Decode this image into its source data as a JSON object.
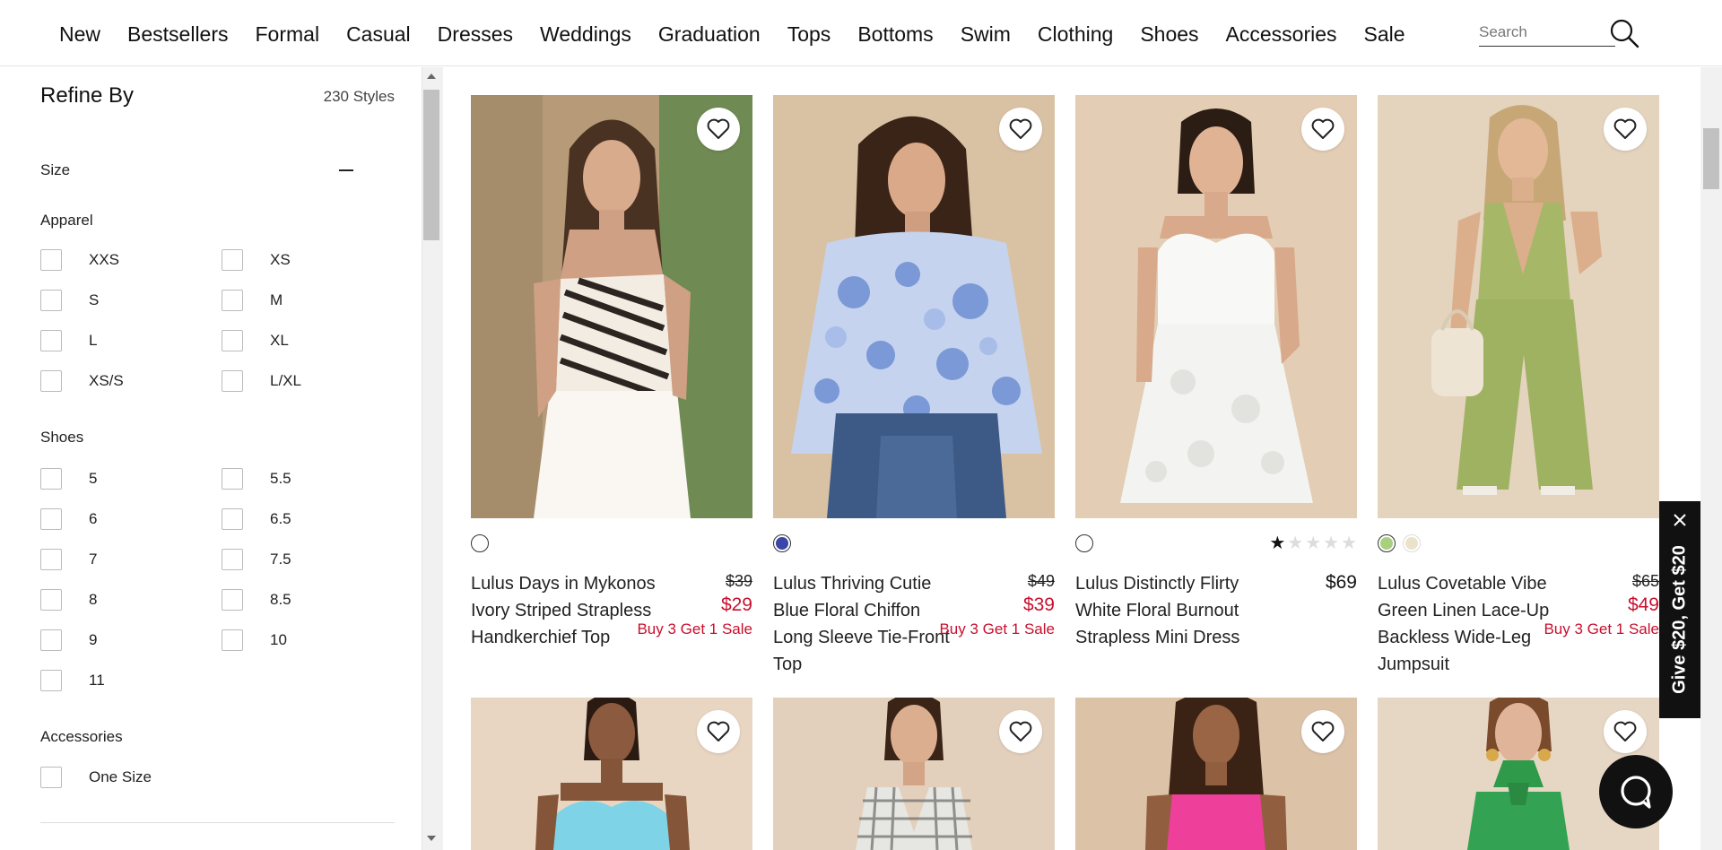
{
  "nav": {
    "items": [
      "New",
      "Bestsellers",
      "Formal",
      "Casual",
      "Dresses",
      "Weddings",
      "Graduation",
      "Tops",
      "Bottoms",
      "Swim",
      "Clothing",
      "Shoes",
      "Accessories",
      "Sale"
    ],
    "search_placeholder": "Search"
  },
  "filters": {
    "title": "Refine By",
    "count": "230 Styles",
    "size_heading": "Size",
    "apparel_heading": "Apparel",
    "apparel_options": [
      "XXS",
      "XS",
      "S",
      "M",
      "L",
      "XL",
      "XS/S",
      "L/XL"
    ],
    "shoes_heading": "Shoes",
    "shoe_options": [
      "5",
      "5.5",
      "6",
      "6.5",
      "7",
      "7.5",
      "8",
      "8.5",
      "9",
      "10",
      "11"
    ],
    "accessories_heading": "Accessories",
    "accessory_options": [
      "One Size"
    ]
  },
  "products": [
    {
      "name": "Lulus Days in Mykonos Ivory Striped Strapless Handkerchief Top",
      "price_old": "$39",
      "price_now": "$29",
      "promo": "Buy 3 Get 1 Sale",
      "swatches": [
        "#ffffff"
      ],
      "rating": null
    },
    {
      "name": "Lulus Thriving Cutie Blue Floral Chiffon Long Sleeve Tie-Front Top",
      "price_old": "$49",
      "price_now": "$39",
      "promo": "Buy 3 Get 1 Sale",
      "swatches": [
        "#3a47a8"
      ],
      "rating": null
    },
    {
      "name": "Lulus Distinctly Flirty White Floral Burnout Strapless Mini Dress",
      "price": "$69",
      "swatches": [
        "#ffffff"
      ],
      "rating": 1
    },
    {
      "name": "Lulus Covetable Vibe Green Linen Lace-Up Backless Wide-Leg Jumpsuit",
      "price_old": "$65",
      "price_now": "$49",
      "promo": "Buy 3 Get 1 Sale",
      "swatches": [
        "#a9d07d",
        "#ece2cb"
      ],
      "rating": null
    }
  ],
  "side_tab": {
    "label": "Give $20, Get $20"
  },
  "colors": {
    "sale_red": "#c8102e",
    "dark": "#111111"
  }
}
